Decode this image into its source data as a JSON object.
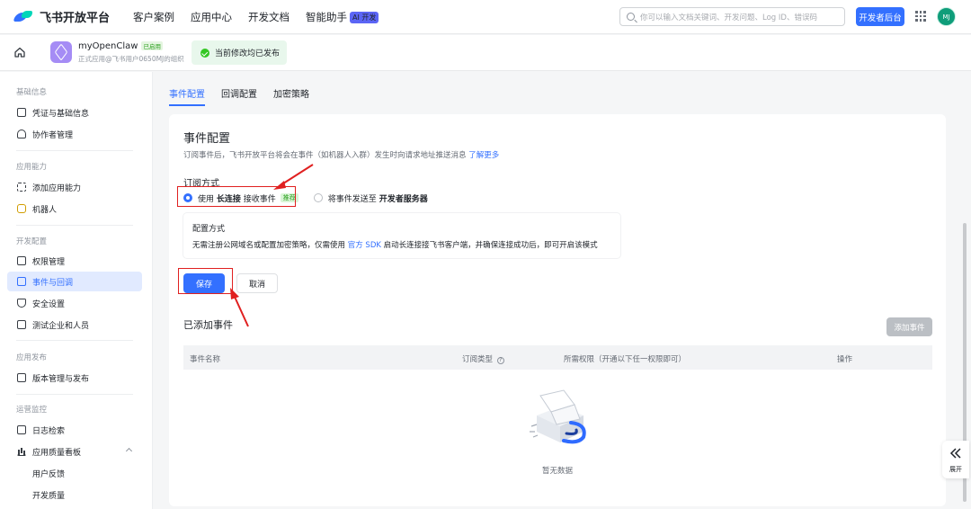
{
  "topbar": {
    "brand": "飞书开放平台",
    "nav": [
      "客户案例",
      "应用中心",
      "开发文档",
      "智能助手"
    ],
    "ai_badge": "AI 开发",
    "search_placeholder": "你可以输入文档关键词、开发问题、Log ID、错误码",
    "dev_console": "开发者后台",
    "avatar": "MJ"
  },
  "app": {
    "name": "myOpenClaw",
    "status": "已启用",
    "subtitle": "正式应用@飞书用户0650MJ的组织",
    "publish_status": "当前修改均已发布"
  },
  "sidebar": {
    "groups": {
      "basic": "基础信息",
      "capability": "应用能力",
      "dev_config": "开发配置",
      "release": "应用发布",
      "ops": "运营监控"
    },
    "items": {
      "credentials": "凭证与基础信息",
      "collaborators": "协作者管理",
      "add_capability": "添加应用能力",
      "bot": "机器人",
      "permissions": "权限管理",
      "events": "事件与回调",
      "security": "安全设置",
      "test_org": "测试企业和人员",
      "versions": "版本管理与发布",
      "logs": "日志检索",
      "quality": "应用质量看板",
      "feedback": "用户反馈",
      "dev_quality": "开发质量"
    }
  },
  "tabs": [
    "事件配置",
    "回调配置",
    "加密策略"
  ],
  "card": {
    "title": "事件配置",
    "desc": "订阅事件后，飞书开放平台将会在事件（如机器人入群）发生时向请求地址推送消息",
    "learn_more": "了解更多",
    "subscribe_title": "订阅方式",
    "option1_pre": "使用",
    "option1_bold": "长连接",
    "option1_post": "接收事件",
    "recommend": "推荐",
    "option2_pre": "将事件发送至",
    "option2_bold": "开发者服务器",
    "config_title": "配置方式",
    "config_pre": "无需注册公网域名或配置加密策略，仅需使用",
    "config_link": "官方 SDK",
    "config_post": "启动长连接接飞书客户端，并确保连接成功后，即可开启该模式",
    "save": "保存",
    "cancel": "取消",
    "events_title": "已添加事件",
    "add_event": "添加事件",
    "columns": [
      "事件名称",
      "订阅类型",
      "所需权限（开通以下任一权限即可）",
      "操作"
    ],
    "empty": "暂无数据"
  },
  "float_panel": {
    "label": "展开"
  },
  "colors": {
    "accent": "#3370ff",
    "annotation": "#e02020",
    "success": "#34c724"
  }
}
